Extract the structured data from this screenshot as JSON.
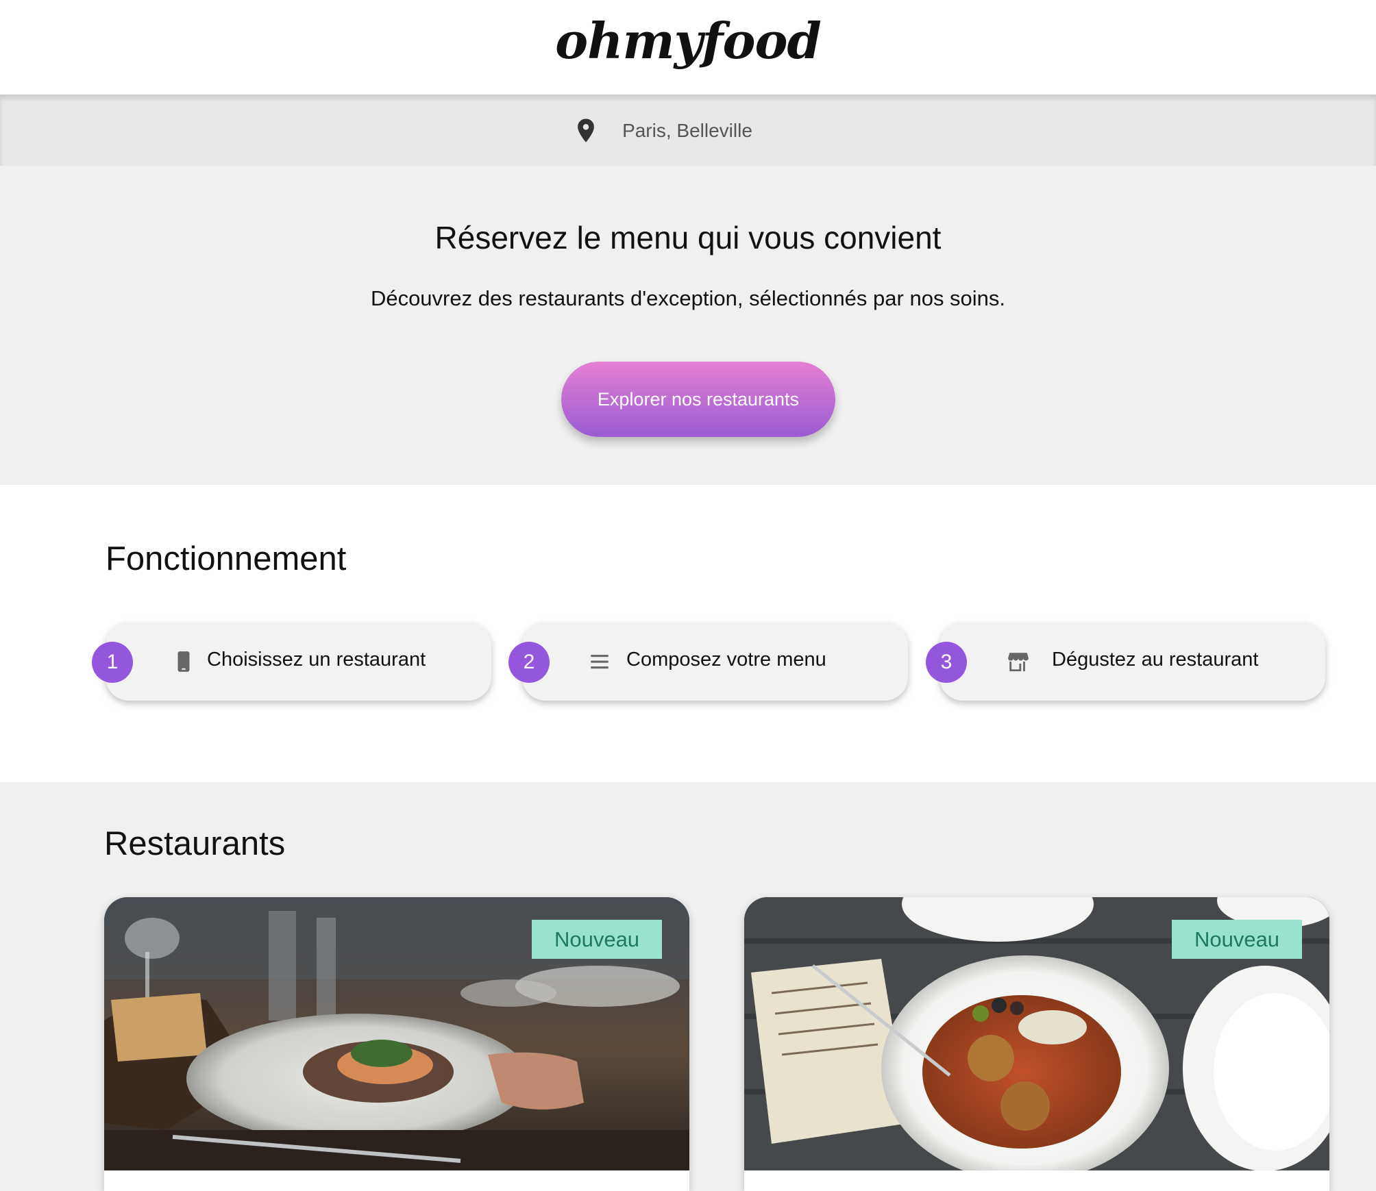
{
  "header": {
    "logo": "ohmyfood"
  },
  "location": {
    "icon": "map-pin-icon",
    "text": "Paris, Belleville"
  },
  "hero": {
    "title": "Réservez le menu qui vous convient",
    "subtitle": "Découvrez des restaurants d'exception, sélectionnés par nos soins.",
    "button_label": "Explorer nos restaurants",
    "button_gradient": [
      "#e57fd3",
      "#9a5cd3"
    ]
  },
  "how": {
    "title": "Fonctionnement",
    "steps": [
      {
        "number": "1",
        "icon": "phone-icon",
        "label": "Choisissez un restaurant"
      },
      {
        "number": "2",
        "icon": "list-icon",
        "label": "Composez votre menu"
      },
      {
        "number": "3",
        "icon": "storefront-icon",
        "label": "Dégustez au restaurant"
      }
    ],
    "accent_color": "#9356dc"
  },
  "restaurants": {
    "title": "Restaurants",
    "cards": [
      {
        "badge": "Nouveau",
        "image": "restaurant-dish-photo"
      },
      {
        "badge": "Nouveau",
        "image": "meatballs-plate-photo"
      }
    ],
    "badge_color": "#99e2d0",
    "badge_text_color": "#1d7a5e"
  }
}
